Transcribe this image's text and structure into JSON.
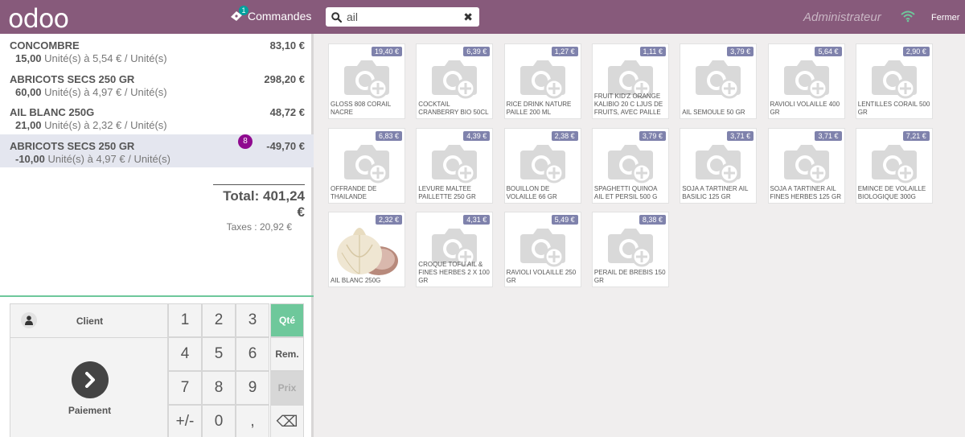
{
  "header": {
    "logo": "odoo",
    "orders_label": "Commandes",
    "orders_count": "1",
    "search_value": "ail",
    "search_clear": "✖",
    "username": "Administrateur",
    "close_label": "Fermer"
  },
  "order": {
    "lines": [
      {
        "name": "CONCOMBRE",
        "price": "83,10 €",
        "qty": "15,00",
        "info": "Unité(s) à 5,54 € / Unité(s)",
        "selected": false
      },
      {
        "name": "ABRICOTS SECS 250 GR",
        "price": "298,20 €",
        "qty": "60,00",
        "info": "Unité(s) à 4,97 € / Unité(s)",
        "selected": false
      },
      {
        "name": "AIL BLANC 250G",
        "price": "48,72 €",
        "qty": "21,00",
        "info": "Unité(s) à 2,32 € / Unité(s)",
        "selected": false
      },
      {
        "name": "ABRICOTS SECS 250 GR",
        "price": "-49,70 €",
        "qty": "-10,00",
        "info": "Unité(s) à 4,97 € / Unité(s)",
        "selected": true,
        "badge": "8"
      }
    ],
    "total": "Total: 401,24 €",
    "taxes": "Taxes : 20,92 €"
  },
  "pad": {
    "client_label": "Client",
    "pay_label": "Paiement",
    "keys": [
      "1",
      "2",
      "3",
      "4",
      "5",
      "6",
      "7",
      "8",
      "9",
      "+/-",
      "0",
      ","
    ],
    "mode_qty": "Qté",
    "mode_disc": "Rem.",
    "mode_price": "Prix",
    "backspace": "⌫"
  },
  "products": [
    {
      "price": "19,40 €",
      "name": "GLOSS 808 CORAIL NACRE"
    },
    {
      "price": "6,39 €",
      "name": "COCKTAIL CRANBERRY BIO 50CL"
    },
    {
      "price": "1,27 €",
      "name": "RICE DRINK NATURE PAILLE 200 ML"
    },
    {
      "price": "1,11 €",
      "name": "FRUIT KID'Z ORANGE KALIBIO 20 C LJUS DE FRUITS, AVEC PAILLE"
    },
    {
      "price": "3,79 €",
      "name": "AIL SEMOULE 50 GR"
    },
    {
      "price": "5,64 €",
      "name": "RAVIOLI VOLAILLE 400 GR"
    },
    {
      "price": "2,90 €",
      "name": "LENTILLES CORAIL 500 GR"
    },
    {
      "price": "6,83 €",
      "name": "OFFRANDE DE THAILANDE"
    },
    {
      "price": "4,39 €",
      "name": "LEVURE MALTEE PAILLETTE 250 GR"
    },
    {
      "price": "2,38 €",
      "name": "BOUILLON DE VOLAILLE 66 GR"
    },
    {
      "price": "3,79 €",
      "name": "SPAGHETTI QUINOA AIL ET PERSIL 500 G"
    },
    {
      "price": "3,71 €",
      "name": "SOJA A TARTINER AIL BASILIC 125 GR"
    },
    {
      "price": "3,71 €",
      "name": "SOJA A TARTINER AIL FINES HERBES 125 GR"
    },
    {
      "price": "7,21 €",
      "name": "EMINCE DE VOLAILLE BIOLOGIQUE 300G"
    },
    {
      "price": "2,32 €",
      "name": "AIL BLANC 250G",
      "photo": "garlic"
    },
    {
      "price": "4,31 €",
      "name": "CROQUE TOFU AIL & FINES HERBES 2 X 100 GR"
    },
    {
      "price": "5,49 €",
      "name": "RAVIOLI VOLAILLE 250 GR"
    },
    {
      "price": "8,38 €",
      "name": "PERAIL DE BREBIS 150 GR"
    }
  ],
  "colors": {
    "brand": "#875a7b",
    "accent": "#6ec89b",
    "price_tag": "#7f82ac",
    "badge": "#8f0a8f"
  },
  "icons": {
    "orders": "ticket-icon",
    "search": "search-icon",
    "wifi": "wifi-icon",
    "client": "user-icon",
    "pay": "chevron-right-icon",
    "product_placeholder": "camera-plus-icon"
  }
}
